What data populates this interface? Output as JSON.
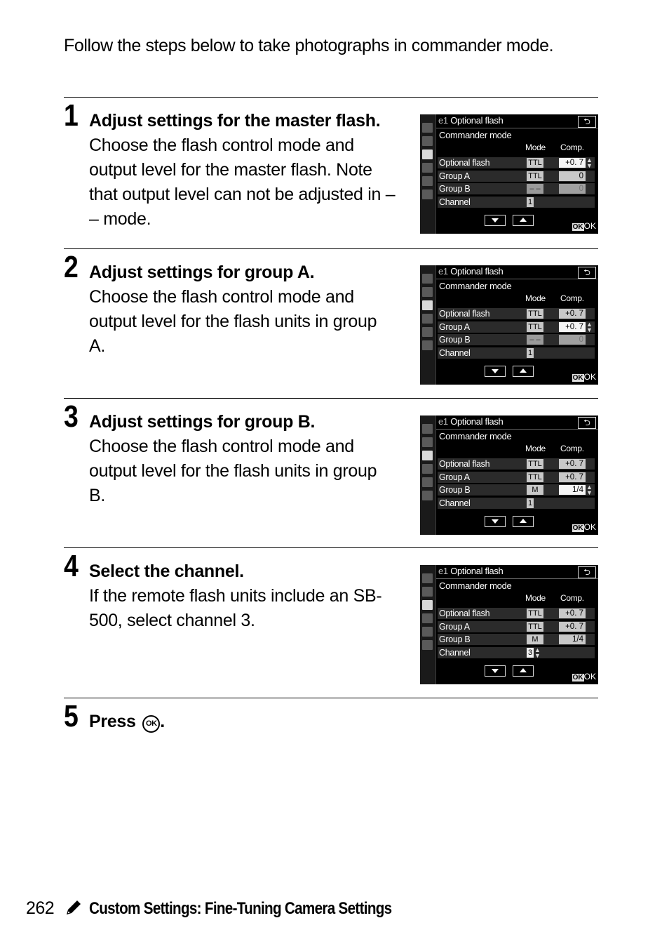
{
  "intro": "Follow the steps below to take photographs in commander mode.",
  "steps": [
    {
      "number": "1",
      "title": "Adjust settings for the master flash.",
      "body": "Choose the flash control mode and output level for the master flash.  Note that output level can not be adjusted in – – mode.",
      "screen": {
        "title_prefix": "e1",
        "title": "Optional flash",
        "subtitle": "Commander mode",
        "col_mode": "Mode",
        "col_comp": "Comp.",
        "rows": [
          {
            "label": "Optional flash",
            "mode": "TTL",
            "comp": "+0. 7",
            "selected": true
          },
          {
            "label": "Group A",
            "mode": "TTL",
            "comp": "0"
          },
          {
            "label": "Group B",
            "mode": "– –",
            "comp": "0",
            "dim": true
          },
          {
            "label": "Channel",
            "mode": "1"
          }
        ],
        "ok_label": "OK"
      }
    },
    {
      "number": "2",
      "title": "Adjust settings for group A.",
      "body": "Choose the flash control mode and output level for the flash units in group A.",
      "screen": {
        "title_prefix": "e1",
        "title": "Optional flash",
        "subtitle": "Commander mode",
        "col_mode": "Mode",
        "col_comp": "Comp.",
        "rows": [
          {
            "label": "Optional flash",
            "mode": "TTL",
            "comp": "+0. 7"
          },
          {
            "label": "Group A",
            "mode": "TTL",
            "comp": "+0. 7",
            "selected": true
          },
          {
            "label": "Group B",
            "mode": "– –",
            "comp": "0",
            "dim": true
          },
          {
            "label": "Channel",
            "mode": "1"
          }
        ],
        "ok_label": "OK"
      }
    },
    {
      "number": "3",
      "title": "Adjust settings for group B.",
      "body": "Choose the flash control mode and output level for the flash units in group B.",
      "screen": {
        "title_prefix": "e1",
        "title": "Optional flash",
        "subtitle": "Commander mode",
        "col_mode": "Mode",
        "col_comp": "Comp.",
        "rows": [
          {
            "label": "Optional flash",
            "mode": "TTL",
            "comp": "+0. 7"
          },
          {
            "label": "Group A",
            "mode": "TTL",
            "comp": "+0. 7"
          },
          {
            "label": "Group B",
            "mode": "M",
            "comp": "1/4",
            "selected": true
          },
          {
            "label": "Channel",
            "mode": "1"
          }
        ],
        "ok_label": "OK"
      }
    },
    {
      "number": "4",
      "title": "Select the channel.",
      "body": "If the remote flash units include an SB-500, select channel 3.",
      "screen": {
        "title_prefix": "e1",
        "title": "Optional flash",
        "subtitle": "Commander mode",
        "col_mode": "Mode",
        "col_comp": "Comp.",
        "rows": [
          {
            "label": "Optional flash",
            "mode": "TTL",
            "comp": "+0. 7"
          },
          {
            "label": "Group A",
            "mode": "TTL",
            "comp": "+0. 7"
          },
          {
            "label": "Group B",
            "mode": "M",
            "comp": "1/4"
          },
          {
            "label": "Channel",
            "mode": "3",
            "selected": true
          }
        ],
        "ok_label": "OK"
      }
    },
    {
      "number": "5",
      "title": "Press",
      "ok_glyph": "OK",
      "title_end": "."
    }
  ],
  "footer": {
    "page_number": "262",
    "icon": "pencil-icon",
    "section_title": "Custom Settings: Fine-Tuning Camera Settings"
  }
}
